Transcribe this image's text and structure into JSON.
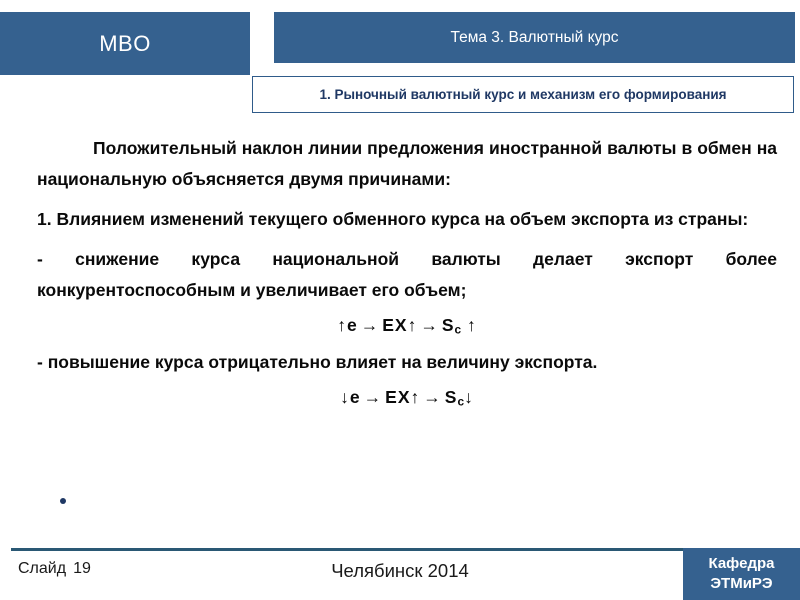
{
  "header": {
    "course_badge": "MBO",
    "topic_title": "Тема 3. Валютный курс",
    "section_title": "1. Рыночный валютный курс и механизм его формирования"
  },
  "body": {
    "paragraphs": [
      "Положительный наклон линии предложения иностранной валюты в обмен на национальную объясняется двумя причинами:",
      "1. Влиянием изменений текущего обменного курса на объем экспорта из страны:",
      "- снижение курса национальной валюты делает экспорт более конкурентоспособным и увеличивает его объем;",
      "- повышение курса отрицательно влияет на величину экспорта."
    ],
    "formulas": [
      {
        "up_e": "↑e",
        "arrow1": "→",
        "ex": "EX↑",
        "arrow2": "→",
        "s_base": "S",
        "s_sub": "c",
        "s_dir": "↑"
      },
      {
        "up_e": "↓e",
        "arrow1": "→",
        "ex": "EX↑",
        "arrow2": "→",
        "s_base": "S",
        "s_sub": "c",
        "s_dir": "↓"
      }
    ],
    "trailing_bullet": ""
  },
  "footer": {
    "slide_label": "Слайд",
    "slide_number": "19",
    "city_year": "Челябинск 2014",
    "department_line1": "Кафедра",
    "department_line2": "ЭТМиРЭ"
  },
  "colors": {
    "accent_blue": "#35618F",
    "dark_navy": "#1F3864",
    "rule": "#2A5874"
  }
}
